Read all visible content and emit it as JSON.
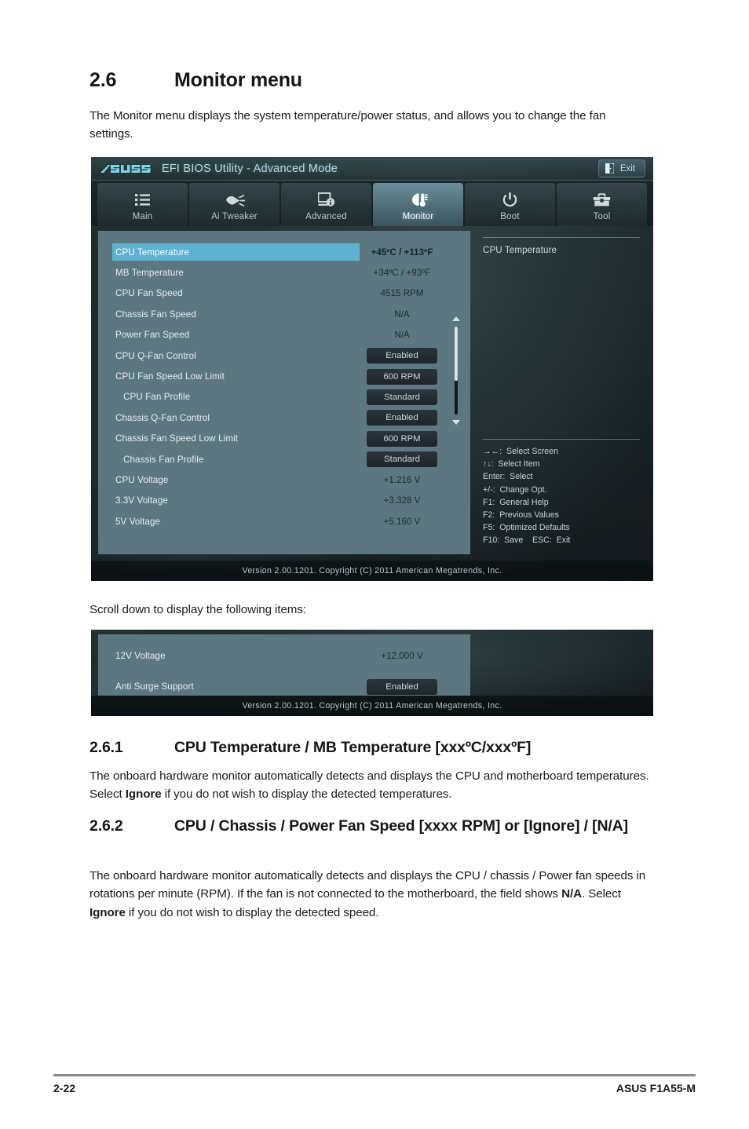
{
  "document": {
    "section": {
      "number": "2.6",
      "title": "Monitor menu"
    },
    "intro": "The Monitor menu displays the system temperature/power status, and allows you to change the fan settings.",
    "scroll_note": "Scroll down to display the following items:",
    "subsections": [
      {
        "number": "2.6.1",
        "title": "CPU Temperature / MB Temperature [xxxºC/xxxºF]",
        "body_html": "The onboard hardware monitor automatically detects and displays the CPU and motherboard temperatures. Select <b>Ignore</b> if you do not wish to display the detected temperatures."
      },
      {
        "number": "2.6.2",
        "title": "CPU / Chassis / Power Fan Speed [xxxx RPM] or [Ignore] / [N/A]",
        "body_html": "The onboard hardware monitor automatically detects and displays the CPU / chassis / Power fan speeds in rotations per minute (RPM). If the fan is not connected to the motherboard, the field shows <b>N/A</b>. Select <b>Ignore</b> if you do not wish to display the detected speed."
      }
    ],
    "footer": {
      "page_number": "2-22",
      "product": "ASUS F1A55-M"
    }
  },
  "bios": {
    "brand": "ASUS",
    "title": "EFI BIOS Utility - Advanced Mode",
    "exit_label": "Exit",
    "tabs": [
      {
        "label": "Main",
        "icon": "list-icon",
        "active": false
      },
      {
        "label": "Ai  Tweaker",
        "icon": "tuning-icon",
        "active": false
      },
      {
        "label": "Advanced",
        "icon": "advanced-info-icon",
        "active": false
      },
      {
        "label": "Monitor",
        "icon": "monitor-gauge-icon",
        "active": true
      },
      {
        "label": "Boot",
        "icon": "power-icon",
        "active": false
      },
      {
        "label": "Tool",
        "icon": "toolbox-icon",
        "active": false
      }
    ],
    "items": [
      {
        "label": "CPU Temperature",
        "value": "+45ºC / +113ºF",
        "kind": "value",
        "selected": true,
        "indent": false
      },
      {
        "label": "MB Temperature",
        "value": "+34ºC / +93ºF",
        "kind": "value",
        "selected": false,
        "indent": false
      },
      {
        "label": "CPU Fan Speed",
        "value": "4515 RPM",
        "kind": "value",
        "selected": false,
        "indent": false
      },
      {
        "label": "Chassis Fan Speed",
        "value": "N/A",
        "kind": "value",
        "selected": false,
        "indent": false
      },
      {
        "label": "Power Fan Speed",
        "value": "N/A",
        "kind": "value",
        "selected": false,
        "indent": false
      },
      {
        "label": "CPU Q-Fan Control",
        "value": "Enabled",
        "kind": "option",
        "selected": false,
        "indent": false
      },
      {
        "label": "CPU Fan Speed Low Limit",
        "value": "600 RPM",
        "kind": "option",
        "selected": false,
        "indent": false
      },
      {
        "label": "CPU Fan Profile",
        "value": "Standard",
        "kind": "option",
        "selected": false,
        "indent": true
      },
      {
        "label": "Chassis Q-Fan Control",
        "value": "Enabled",
        "kind": "option",
        "selected": false,
        "indent": false
      },
      {
        "label": "Chassis Fan Speed Low Limit",
        "value": "600 RPM",
        "kind": "option",
        "selected": false,
        "indent": false
      },
      {
        "label": "Chassis Fan Profile",
        "value": "Standard",
        "kind": "option",
        "selected": false,
        "indent": true
      },
      {
        "label": "CPU Voltage",
        "value": "+1.216 V",
        "kind": "value",
        "selected": false,
        "indent": false
      },
      {
        "label": "3.3V Voltage",
        "value": "+3.328 V",
        "kind": "value",
        "selected": false,
        "indent": false
      },
      {
        "label": "5V Voltage",
        "value": "+5.160 V",
        "kind": "value",
        "selected": false,
        "indent": false
      }
    ],
    "help_title": "CPU Temperature",
    "key_legend": [
      "→←:  Select Screen",
      "↑↓:  Select Item",
      "Enter:  Select",
      "+/-:  Change Opt.",
      "F1:  General Help",
      "F2:  Previous Values",
      "F5:  Optimized Defaults",
      "F10:  Save    ESC:  Exit"
    ],
    "version": "Version  2.00.1201.   Copyright  (C)  2011  American  Megatrends,  Inc.",
    "scroll_items": [
      {
        "label": "12V Voltage",
        "value": "+12.000 V",
        "kind": "value",
        "selected": false,
        "indent": false
      },
      {
        "label": "Anti Surge Support",
        "value": "Enabled",
        "kind": "option",
        "selected": false,
        "indent": false
      }
    ]
  },
  "colors": {
    "pane": "#5d7781",
    "highlight": "#5cb3d1",
    "accent": "#8fd8ec",
    "option_bg": "#232c33"
  }
}
